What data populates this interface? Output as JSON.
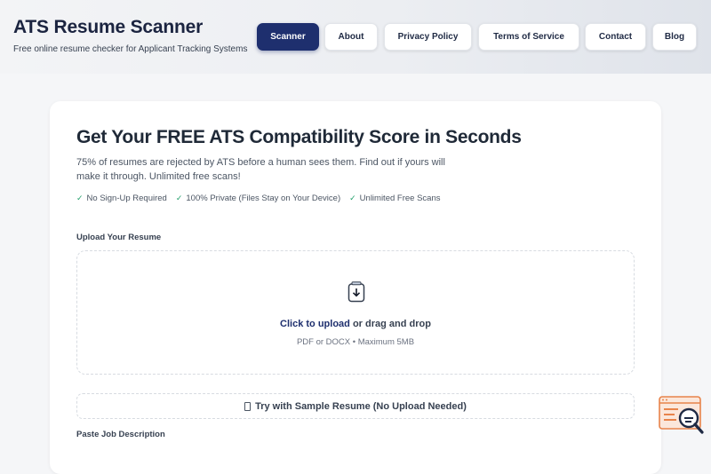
{
  "brand": {
    "title": "ATS Resume Scanner",
    "subtitle": "Free online resume checker for Applicant Tracking Systems"
  },
  "nav": {
    "items": [
      {
        "label": "Scanner",
        "active": true
      },
      {
        "label": "About",
        "active": false
      },
      {
        "label": "Privacy Policy",
        "active": false
      },
      {
        "label": "Terms of Service",
        "active": false
      },
      {
        "label": "Contact",
        "active": false
      },
      {
        "label": "Blog",
        "active": false
      }
    ]
  },
  "hero": {
    "title": "Get Your FREE ATS Compatibility Score in Seconds",
    "subtitle": "75% of resumes are rejected by ATS before a human sees them. Find out if yours will make it through. Unlimited free scans!",
    "features": [
      "No Sign-Up Required",
      "100% Private (Files Stay on Your Device)",
      "Unlimited Free Scans"
    ]
  },
  "upload": {
    "label": "Upload Your Resume",
    "link_text": "Click to upload",
    "rest_text": " or drag and drop",
    "hint": "PDF or DOCX • Maximum 5MB",
    "sample_button": "Try with Sample Resume (No Upload Needed)"
  },
  "job_description": {
    "label": "Paste Job Description"
  },
  "colors": {
    "accent": "#1e2f6e",
    "check": "#22a06b",
    "widget": "#e8834a"
  },
  "icons": {
    "upload": "upload-file-icon",
    "check": "check-icon",
    "widget": "support-widget-icon"
  }
}
